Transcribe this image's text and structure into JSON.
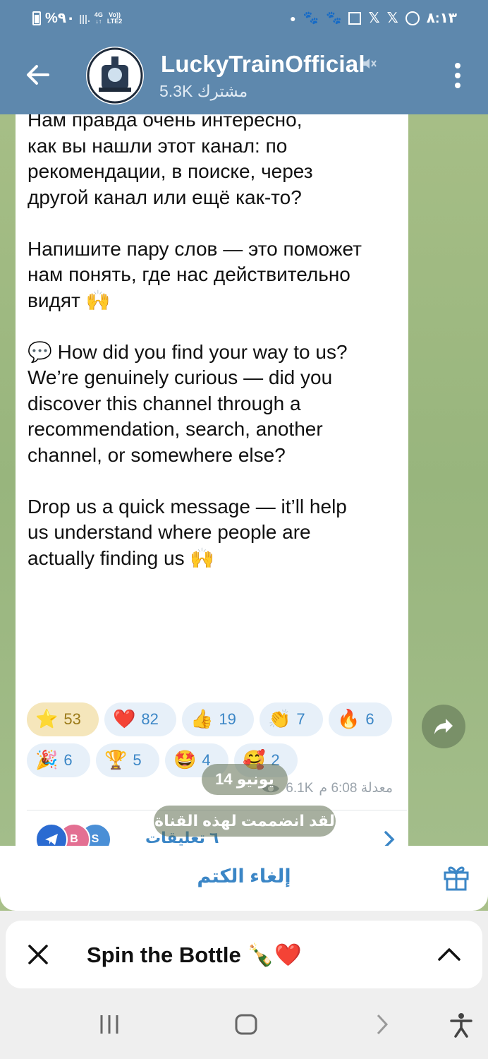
{
  "status_bar": {
    "battery": "%٩٠",
    "net_4g": "4G",
    "volte": "Vo))",
    "lte": "LTE2",
    "time": "٨:١٣"
  },
  "header": {
    "title": "LuckyTrainOfficial",
    "subscribers": "5.3K مشترك"
  },
  "message": {
    "text": "Нам правда очень интересно,\nкак вы нашли этот канал: по\nрекомендации, в поиске, через\nдругой канал или ещё как-то?\n\nНапишите пару слов — это поможет\nнам понять, где нас действительно\nвидят 🙌\n\n💬 How did you find your way to us?\nWe’re genuinely curious — did you\ndiscover this channel through a\nrecommendation, search, another\nchannel, or somewhere else?\n\nDrop us a quick message — it’ll help\nus understand where people are\nactually finding us 🙌",
    "reactions": [
      {
        "emoji": "⭐",
        "count": "53"
      },
      {
        "emoji": "❤️",
        "count": "82"
      },
      {
        "emoji": "👍",
        "count": "19"
      },
      {
        "emoji": "👏",
        "count": "7"
      },
      {
        "emoji": "🔥",
        "count": "6"
      },
      {
        "emoji": "🎉",
        "count": "6"
      },
      {
        "emoji": "🏆",
        "count": "5"
      },
      {
        "emoji": "🤩",
        "count": "4"
      },
      {
        "emoji": "🥰",
        "count": "2"
      }
    ],
    "views": "6.1K",
    "time": "معدلة 6:08 م",
    "comments_label": "٦ تعليقات",
    "comment_avatars": [
      "B",
      "S"
    ]
  },
  "service": {
    "date": "14 يونيو",
    "joined": "لقد انضممت لهذه القناة"
  },
  "bottom": {
    "unmute_label": "إلغاء الكتم",
    "card_title": "Spin the Bottle",
    "card_emoji": "🍾❤️"
  },
  "colors": {
    "header": "#5e88ad",
    "accent": "#3b86c6",
    "chat_bg": "#a6be86"
  }
}
